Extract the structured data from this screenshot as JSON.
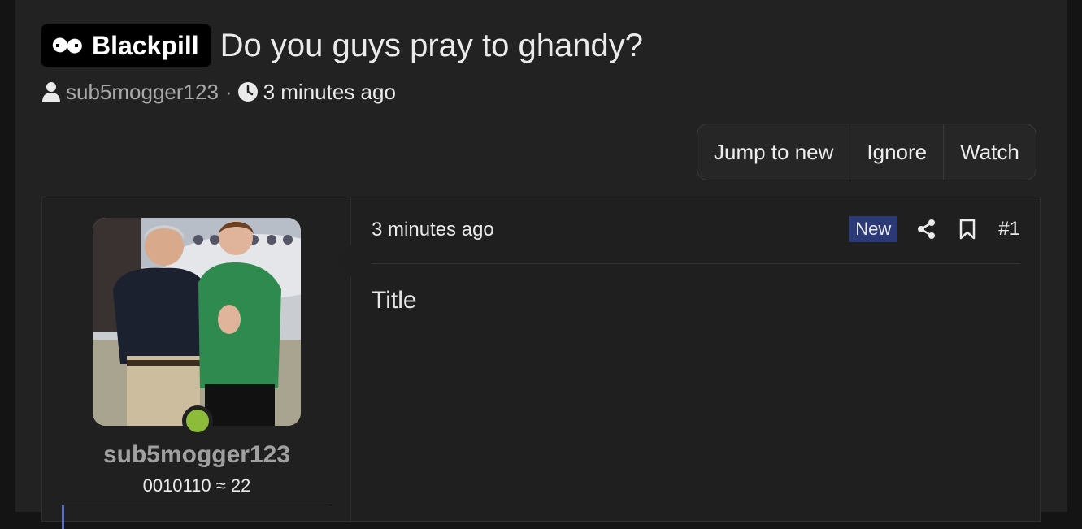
{
  "thread": {
    "prefix": "Blackpill",
    "title": "Do you guys pray to ghandy?",
    "author": "sub5mogger123",
    "separator": "·",
    "time": "3 minutes ago"
  },
  "actions": {
    "jump_to_new": "Jump to new",
    "ignore": "Ignore",
    "watch": "Watch"
  },
  "post": {
    "user": {
      "name": "sub5mogger123",
      "title": "0010110 ≈ 22",
      "online_status_color": "#8cbc3a"
    },
    "time": "3 minutes ago",
    "new_badge": "New",
    "post_number": "#1",
    "body": "Title"
  },
  "colors": {
    "background": "#222222",
    "new_badge": "#2b3a77",
    "prefix_badge": "#000000"
  }
}
